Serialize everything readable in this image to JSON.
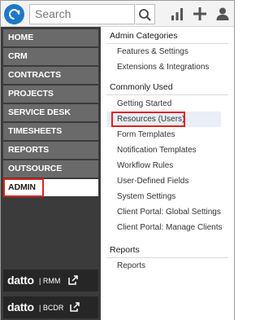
{
  "search": {
    "placeholder": "Search"
  },
  "toolbar": {
    "icons": [
      "search-icon",
      "bar-chart-icon",
      "plus-icon",
      "user-icon"
    ]
  },
  "nav": {
    "items": [
      {
        "label": "HOME"
      },
      {
        "label": "CRM"
      },
      {
        "label": "CONTRACTS"
      },
      {
        "label": "PROJECTS"
      },
      {
        "label": "SERVICE DESK"
      },
      {
        "label": "TIMESHEETS"
      },
      {
        "label": "REPORTS"
      },
      {
        "label": "OUTSOURCE"
      },
      {
        "label": "ADMIN",
        "active": true
      }
    ],
    "brands": [
      {
        "name": "datto",
        "product": "RMM"
      },
      {
        "name": "datto",
        "product": "BCDR"
      }
    ]
  },
  "menu": {
    "admin_categories": {
      "title": "Admin Categories",
      "items": [
        "Features & Settings",
        "Extensions & Integrations"
      ]
    },
    "commonly_used": {
      "title": "Commonly Used",
      "items": [
        "Getting Started",
        "Resources (Users)",
        "Form Templates",
        "Notification Templates",
        "Workflow Rules",
        "User-Defined Fields",
        "System Settings",
        "Client Portal: Global Settings",
        "Client Portal: Manage Clients"
      ]
    },
    "reports": {
      "title": "Reports",
      "items": [
        "Reports"
      ]
    }
  },
  "colors": {
    "accent": "#1e78c8",
    "highlight": "#e0231d",
    "nav_bg": "#3b3b3b",
    "nav_item": "#6a6a6a"
  }
}
